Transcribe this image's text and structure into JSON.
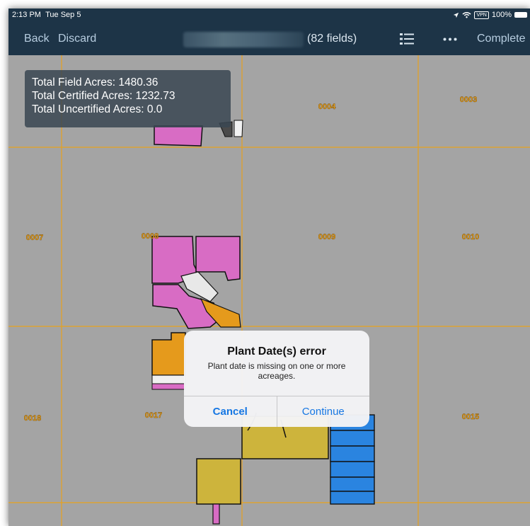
{
  "status": {
    "time": "2:13 PM",
    "date": "Tue Sep 5",
    "vpn": "VPN",
    "battery": "100%",
    "location_icon": "location-arrow-icon",
    "wifi_icon": "wifi-icon"
  },
  "nav": {
    "back": "Back",
    "discard": "Discard",
    "field_count": "(82 fields)",
    "list_icon": "list-icon",
    "more_icon": "more-icon",
    "complete": "Complete"
  },
  "info": {
    "total_field": "Total Field Acres: 1480.36",
    "total_certified": "Total Certified Acres: 1232.73",
    "total_uncertified": "Total Uncertified Acres: 0.0"
  },
  "map": {
    "colors": {
      "grid": "#e6a21e",
      "pink": "#d86cc4",
      "orange": "#e59a1c",
      "yellow": "#cdb43c",
      "blue": "#2a84e0",
      "white": "#e8e8e8",
      "background": "#a4a4a4"
    },
    "section_labels": [
      "0004",
      "0003",
      "0007",
      "0008",
      "0009",
      "0010",
      "0018",
      "0017",
      "0015"
    ]
  },
  "dialog": {
    "title": "Plant Date(s) error",
    "message": "Plant date is missing on one or more acreages.",
    "cancel": "Cancel",
    "continue": "Continue"
  }
}
